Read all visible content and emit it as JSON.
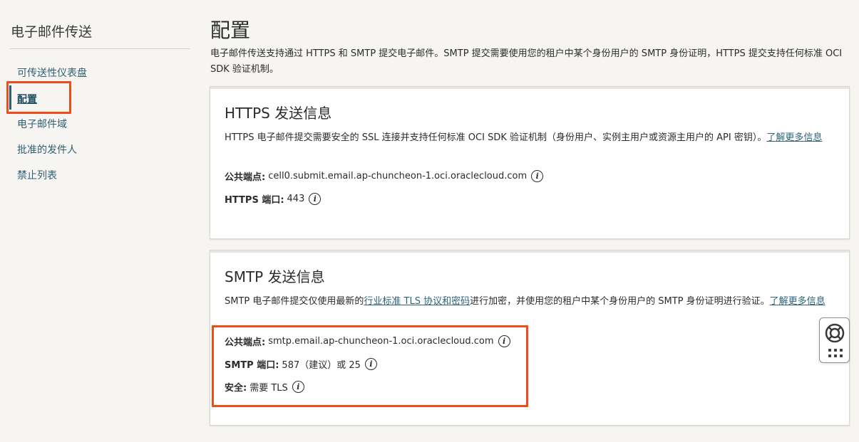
{
  "sidebar": {
    "title": "电子邮件传送",
    "items": [
      {
        "label": "可传送性仪表盘"
      },
      {
        "label": "配置"
      },
      {
        "label": "电子邮件域"
      },
      {
        "label": "批准的发件人"
      },
      {
        "label": "禁止列表"
      }
    ]
  },
  "main": {
    "title": "配置",
    "description": "电子邮件传送支持通过 HTTPS 和 SMTP 提交电子邮件。SMTP 提交需要使用您的租户中某个身份用户的 SMTP 身份证明，HTTPS 提交支持任何标准 OCI SDK 验证机制。"
  },
  "https_card": {
    "title": "HTTPS 发送信息",
    "description": "HTTPS 电子邮件提交需要安全的 SSL 连接并支持任何标准 OCI SDK 验证机制（身份用户、实例主用户或资源主用户的 API 密钥）。",
    "link": "了解更多信息",
    "endpoint_label": "公共端点:",
    "endpoint_value": "cell0.submit.email.ap-chuncheon-1.oci.oraclecloud.com",
    "port_label": "HTTPS 端口:",
    "port_value": "443"
  },
  "smtp_card": {
    "title": "SMTP 发送信息",
    "description_pre": "SMTP 电子邮件提交仅使用最新的",
    "inline_link": "行业标准 TLS 协议和密码",
    "description_post": "进行加密，并使用您的租户中某个身份用户的 SMTP 身份证明进行验证。",
    "link": "了解更多信息",
    "endpoint_label": "公共端点:",
    "endpoint_value": "smtp.email.ap-chuncheon-1.oci.oraclecloud.com",
    "port_label": "SMTP 端口:",
    "port_value": "587（建议）或 25",
    "security_label": "安全:",
    "security_value": "需要 TLS"
  },
  "icons": {
    "info": "i",
    "help": "lifebuoy-icon",
    "apps": "grid-dots-icon"
  },
  "colors": {
    "highlight": "#f04b1b",
    "link": "#2d6478",
    "nav": "#2f5f73",
    "background": "#f6f5f1"
  }
}
